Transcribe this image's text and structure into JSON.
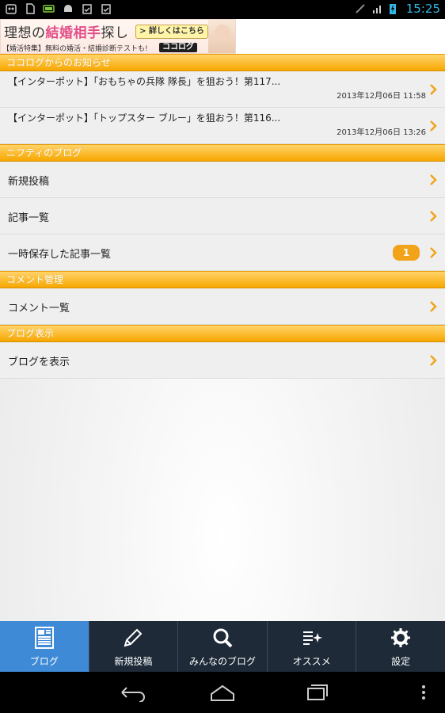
{
  "status_bar": {
    "time": "15:25",
    "left_icons": [
      "android-debug-icon",
      "sd-card-icon",
      "battery-widget-icon",
      "android-icon",
      "clipboard-check-icon",
      "clipboard-check-icon"
    ],
    "right_icons": [
      "signal-off-icon",
      "wifi-hspa-icon",
      "battery-charging-icon"
    ]
  },
  "ad": {
    "title_prefix": "理想の",
    "title_highlight": "結婚相手",
    "title_suffix": "探し",
    "button": "詳しくはこちら",
    "sub": "【婚活特集】無料の婚活・結婚診断テストも!",
    "brand": "ココログ"
  },
  "sections": {
    "news_header": "ココログからのお知らせ",
    "blog_header": "ニフティのブログ",
    "comments_header": "コメント管理",
    "view_header": "ブログ表示"
  },
  "news": [
    {
      "title": "【インターポット】「おもちゃの兵隊 隊長」を狙おう！第117...",
      "date": "2013年12月06日 11:58"
    },
    {
      "title": "【インターポット】「トップスター ブルー」を狙おう！第116...",
      "date": "2013年12月06日 13:26"
    }
  ],
  "blog_menu": {
    "new_post": "新規投稿",
    "article_list": "記事一覧",
    "drafts": "一時保存した記事一覧",
    "drafts_count": "1"
  },
  "comments_menu": {
    "comment_list": "コメント一覧"
  },
  "view_menu": {
    "show_blog": "ブログを表示"
  },
  "tabs": [
    {
      "label": "ブログ",
      "icon": "blog-document-icon",
      "active": true
    },
    {
      "label": "新規投稿",
      "icon": "pencil-icon",
      "active": false
    },
    {
      "label": "みんなのブログ",
      "icon": "magnifier-icon",
      "active": false
    },
    {
      "label": "オススメ",
      "icon": "sparkle-list-icon",
      "active": false
    },
    {
      "label": "設定",
      "icon": "gear-icon",
      "active": false
    }
  ],
  "colors": {
    "accent": "#f7a700",
    "tab_active": "#3e8ad6",
    "tab_bg": "#1e2a38",
    "badge": "#f2a31a",
    "clock": "#33b5e5"
  }
}
